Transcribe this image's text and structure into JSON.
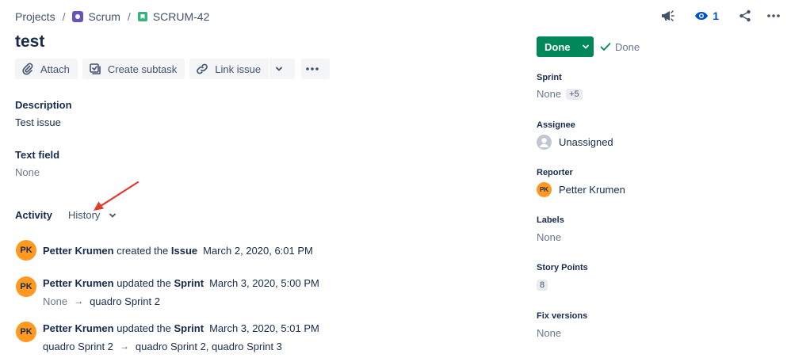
{
  "breadcrumb": {
    "projects": "Projects",
    "project": "Scrum",
    "issue_key": "SCRUM-42",
    "separator": "/"
  },
  "top_actions": {
    "watch_count": "1",
    "icons": [
      "megaphone-icon",
      "eye-icon",
      "share-icon",
      "more-icon"
    ]
  },
  "issue": {
    "title": "test"
  },
  "toolbar": {
    "attach": "Attach",
    "create_subtask": "Create subtask",
    "link_issue": "Link issue"
  },
  "fields": {
    "description_label": "Description",
    "description_value": "Test issue",
    "text_field_label": "Text field",
    "text_field_value": "None"
  },
  "activity": {
    "label": "Activity",
    "filter": "History",
    "entries": [
      {
        "initials": "PK",
        "author": "Petter Krumen",
        "verb": "created the",
        "target": "Issue",
        "time": "March 2, 2020, 6:01 PM"
      },
      {
        "initials": "PK",
        "author": "Petter Krumen",
        "verb": "updated the",
        "target": "Sprint",
        "time": "March 3, 2020, 5:00 PM",
        "from": "None",
        "to": "quadro Sprint 2"
      },
      {
        "initials": "PK",
        "author": "Petter Krumen",
        "verb": "updated the",
        "target": "Sprint",
        "time": "March 3, 2020, 5:01 PM",
        "from": "quadro Sprint 2",
        "to": "quadro Sprint 2, quadro Sprint 3"
      }
    ],
    "arrow_glyph": "→"
  },
  "sidebar": {
    "status": "Done",
    "resolution": "Done",
    "sprint_label": "Sprint",
    "sprint_value": "None",
    "sprint_more": "+5",
    "assignee_label": "Assignee",
    "assignee_value": "Unassigned",
    "reporter_label": "Reporter",
    "reporter_initials": "PK",
    "reporter_value": "Petter Krumen",
    "labels_label": "Labels",
    "labels_value": "None",
    "story_points_label": "Story Points",
    "story_points_value": "8",
    "fix_versions_label": "Fix versions",
    "fix_versions_value": "None"
  },
  "colors": {
    "status_green": "#00875a",
    "avatar_orange": "#ff991f",
    "link_blue": "#0052cc",
    "annotation_red": "#e53a2b"
  }
}
